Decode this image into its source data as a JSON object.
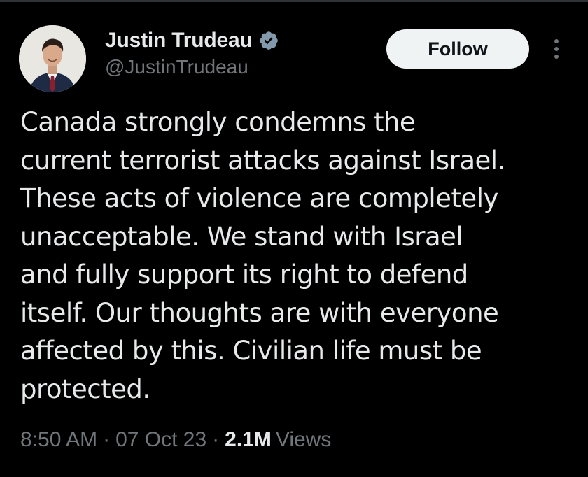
{
  "tweet": {
    "author": {
      "display_name": "Justin Trudeau",
      "handle": "@JustinTrudeau",
      "verified_icon": "verified-badge-icon",
      "avatar_icon": "profile-photo"
    },
    "follow_label": "Follow",
    "more_icon": "more-options-icon",
    "text": "Canada strongly condemns the\ncurrent terrorist attacks against Israel.\nThese acts of violence are completely\nunacceptable. We stand with Israel\nand fully support its right to defend\nitself. Our thoughts are with everyone\naffected by this. Civilian life must be\nprotected.",
    "time": "8:50 AM",
    "separator": "·",
    "date": "07 Oct 23",
    "views_count": "2.1M",
    "views_label": "Views"
  },
  "colors": {
    "background": "#000000",
    "primary_text": "#e7e9ea",
    "secondary_text": "#71767b",
    "follow_button_bg": "#eff3f4",
    "verified_badge": "#829aab"
  }
}
